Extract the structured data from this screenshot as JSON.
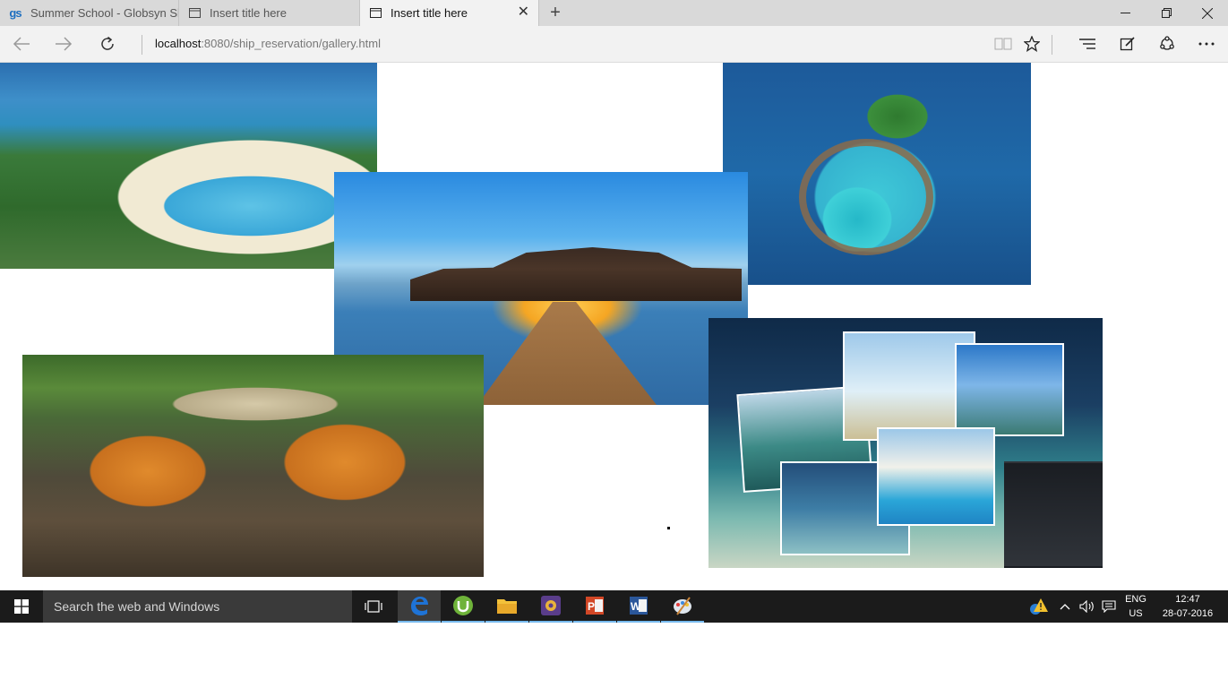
{
  "browser": {
    "tabs": [
      {
        "title": "Summer School - Globsyn Sl",
        "favicon": "globsyn-logo-icon",
        "active": false
      },
      {
        "title": "Insert title here",
        "favicon": "page-icon",
        "active": false
      },
      {
        "title": "Insert title here",
        "favicon": "page-icon",
        "active": true
      }
    ],
    "favicon_text": "gs",
    "new_tab_label": "+",
    "close_tab_label": "✕",
    "address": {
      "host": "localhost",
      "rest": ":8080/ship_reservation/gallery.html"
    },
    "window_controls": {
      "minimize": "—",
      "restore": "❐",
      "close": "✕"
    }
  },
  "gallery": {
    "images": [
      {
        "name": "tropical-resort-bay",
        "colors": [
          "#2b6fb0",
          "#3a7a3a"
        ]
      },
      {
        "name": "overwater-villa-pier",
        "colors": [
          "#2a8ae0",
          "#f5a623"
        ]
      },
      {
        "name": "island-lagoon-aerial",
        "colors": [
          "#1d5a9a",
          "#3fc9d8"
        ]
      },
      {
        "name": "tigers-in-water",
        "colors": [
          "#c8701e",
          "#3c6a2a"
        ]
      },
      {
        "name": "beach-photo-collage",
        "colors": [
          "#0f2a48",
          "#2aa6d8"
        ]
      }
    ]
  },
  "taskbar": {
    "search_placeholder": "Search the web and Windows",
    "apps": [
      "task-view-icon",
      "edge-icon",
      "utorrent-icon",
      "file-explorer-icon",
      "media-app-icon",
      "powerpoint-icon",
      "word-icon",
      "paint-icon"
    ],
    "language": {
      "top": "ENG",
      "bottom": "US"
    },
    "clock": {
      "time": "12:47",
      "date": "28-07-2016"
    }
  },
  "colors": {
    "taskbar": "#1b1b1b",
    "accent": "#76b9ed",
    "edge_blue": "#1e73d6"
  }
}
